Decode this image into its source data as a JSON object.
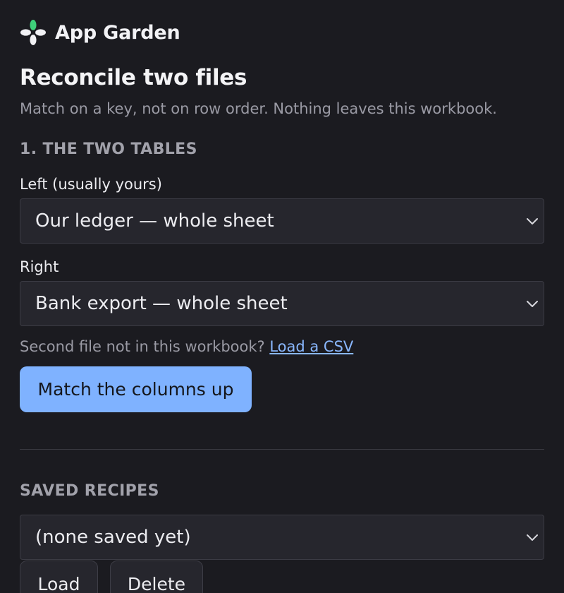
{
  "app": {
    "name": "App Garden",
    "logo_icon": "clover-flower-icon",
    "logo_colors": [
      "#3ecf7a",
      "#f2f2f5"
    ]
  },
  "page": {
    "title": "Reconcile two files",
    "subtitle": "Match on a key, not on row order. Nothing leaves this workbook."
  },
  "tables_section": {
    "heading": "1. THE TWO TABLES",
    "left": {
      "label": "Left (usually yours)",
      "selected": "Our ledger — whole sheet"
    },
    "right": {
      "label": "Right",
      "selected": "Bank export — whole sheet"
    },
    "hint_text": "Second file not in this workbook? ",
    "hint_link": "Load a CSV",
    "match_button": "Match the columns up"
  },
  "recipes_section": {
    "heading": "SAVED RECIPES",
    "selected": "(none saved yet)",
    "load_button": "Load",
    "delete_button": "Delete"
  },
  "colors": {
    "background": "#1b1b20",
    "accent": "#7fb2ff",
    "link": "#8ab8ff"
  }
}
